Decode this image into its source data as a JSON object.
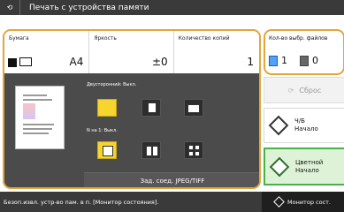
{
  "window": {
    "title": "Печать с устройства памяти"
  },
  "settings": {
    "paper_label": "Бумага",
    "paper_value": "A4",
    "density_label": "Яркость",
    "density_value": "±0",
    "copies_label": "Количество копий",
    "copies_value": "1"
  },
  "preview": {
    "duplex_label": "Двусторонний: Выкл.",
    "n_on_1_label": "N на 1: Выкл.",
    "footer_label": "Зад. соед. JPEG/TIFF"
  },
  "selected_files": {
    "label": "Кол-во выбр. файлов",
    "selected_count": "1",
    "other_count": "0"
  },
  "actions": {
    "reset": "Сброс",
    "bw_start_line1": "Ч/Б",
    "bw_start_line2": "Начало",
    "color_start_line1": "Цветной",
    "color_start_line2": "Начало"
  },
  "status": {
    "message": "Безоп.извл. устр-во пам. в п. [Монитор состояния].",
    "monitor_button": "Монитор сост."
  },
  "colors": {
    "accent_orange": "#e2a63a",
    "title_dark": "#3a3a3a",
    "green_start": "#4bb04b",
    "yellow_option": "#f6d52f"
  }
}
